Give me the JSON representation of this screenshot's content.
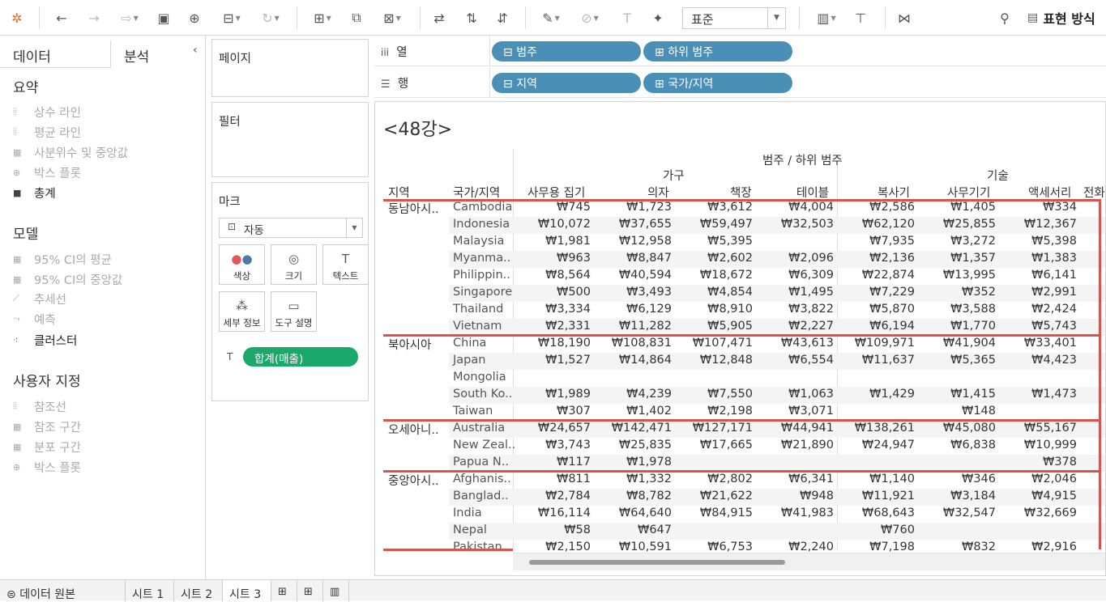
{
  "toolbar": {
    "marks_size_value": "표준",
    "show_me_label": "표현 방식"
  },
  "left_panel": {
    "tab_data": "데이터",
    "tab_analytics": "분석",
    "summary_title": "요약",
    "summary_items": [
      "상수 라인",
      "평균 라인",
      "사분위수 및 중앙값",
      "박스 플롯",
      "총계"
    ],
    "model_title": "모델",
    "model_items": [
      "95% CI의 평균",
      "95% CI의 중앙값",
      "추세선",
      "예측",
      "클러스터"
    ],
    "custom_title": "사용자 지정",
    "custom_items": [
      "참조선",
      "참조 구간",
      "분포 구간",
      "박스 플롯"
    ]
  },
  "cards": {
    "pages_title": "페이지",
    "filters_title": "필터",
    "marks_title": "마크",
    "mark_type": "자동",
    "mark_buttons": [
      "색상",
      "크기",
      "텍스트",
      "세부 정보",
      "도구 설명"
    ],
    "mark_pill": "합계(매출)"
  },
  "shelves": {
    "columns_label": "열",
    "rows_label": "행",
    "column_pills": [
      "범주",
      "하위 범주"
    ],
    "row_pills": [
      "지역",
      "국가/지역"
    ]
  },
  "view": {
    "title": "<48강>",
    "header_top": "범주 / 하위 범주",
    "cat1": "가구",
    "cat2": "기술",
    "row_header_region": "지역",
    "row_header_country": "국가/지역",
    "subcats": [
      "사무용 집기",
      "의자",
      "책장",
      "테이블",
      "복사기",
      "사무기기",
      "액세서리",
      "전화"
    ],
    "regions": [
      "동남아시..",
      "북아시아",
      "오세아니..",
      "중앙아시.."
    ],
    "rows": [
      {
        "country": "Cambodia",
        "vals": [
          "₩745",
          "₩1,723",
          "₩3,612",
          "₩4,004",
          "₩2,586",
          "₩1,405",
          "₩334"
        ]
      },
      {
        "country": "Indonesia",
        "vals": [
          "₩10,072",
          "₩37,655",
          "₩59,497",
          "₩32,503",
          "₩62,120",
          "₩25,855",
          "₩12,367"
        ]
      },
      {
        "country": "Malaysia",
        "vals": [
          "₩1,981",
          "₩12,958",
          "₩5,395",
          "",
          "₩7,935",
          "₩3,272",
          "₩5,398"
        ]
      },
      {
        "country": "Myanma..",
        "vals": [
          "₩963",
          "₩8,847",
          "₩2,602",
          "₩2,096",
          "₩2,136",
          "₩1,357",
          "₩1,383"
        ]
      },
      {
        "country": "Philippin..",
        "vals": [
          "₩8,564",
          "₩40,594",
          "₩18,672",
          "₩6,309",
          "₩22,874",
          "₩13,995",
          "₩6,141"
        ]
      },
      {
        "country": "Singapore",
        "vals": [
          "₩500",
          "₩3,493",
          "₩4,854",
          "₩1,495",
          "₩7,229",
          "₩352",
          "₩2,991"
        ]
      },
      {
        "country": "Thailand",
        "vals": [
          "₩3,334",
          "₩6,129",
          "₩8,910",
          "₩3,822",
          "₩5,870",
          "₩3,588",
          "₩2,424"
        ]
      },
      {
        "country": "Vietnam",
        "vals": [
          "₩2,331",
          "₩11,282",
          "₩5,905",
          "₩2,227",
          "₩6,194",
          "₩1,770",
          "₩5,743"
        ]
      },
      {
        "country": "China",
        "vals": [
          "₩18,190",
          "₩108,831",
          "₩107,471",
          "₩43,613",
          "₩109,971",
          "₩41,904",
          "₩33,401"
        ]
      },
      {
        "country": "Japan",
        "vals": [
          "₩1,527",
          "₩14,864",
          "₩12,848",
          "₩6,554",
          "₩11,637",
          "₩5,365",
          "₩4,423"
        ]
      },
      {
        "country": "Mongolia",
        "vals": [
          "",
          "",
          "",
          "",
          "",
          "",
          ""
        ]
      },
      {
        "country": "South Ko..",
        "vals": [
          "₩1,989",
          "₩4,239",
          "₩7,550",
          "₩1,063",
          "₩1,429",
          "₩1,415",
          "₩1,473"
        ]
      },
      {
        "country": "Taiwan",
        "vals": [
          "₩307",
          "₩1,402",
          "₩2,198",
          "₩3,071",
          "",
          "₩148",
          ""
        ]
      },
      {
        "country": "Australia",
        "vals": [
          "₩24,657",
          "₩142,471",
          "₩127,171",
          "₩44,941",
          "₩138,261",
          "₩45,080",
          "₩55,167"
        ]
      },
      {
        "country": "New Zeal..",
        "vals": [
          "₩3,743",
          "₩25,835",
          "₩17,665",
          "₩21,890",
          "₩24,947",
          "₩6,838",
          "₩10,999"
        ]
      },
      {
        "country": "Papua N..",
        "vals": [
          "₩117",
          "₩1,978",
          "",
          "",
          "",
          "",
          "₩378"
        ]
      },
      {
        "country": "Afghanis..",
        "vals": [
          "₩811",
          "₩1,332",
          "₩2,802",
          "₩6,341",
          "₩1,140",
          "₩346",
          "₩2,046"
        ]
      },
      {
        "country": "Banglad..",
        "vals": [
          "₩2,784",
          "₩8,782",
          "₩21,622",
          "₩948",
          "₩11,921",
          "₩3,184",
          "₩4,915"
        ]
      },
      {
        "country": "India",
        "vals": [
          "₩16,114",
          "₩64,640",
          "₩84,915",
          "₩41,983",
          "₩68,643",
          "₩32,547",
          "₩32,669"
        ]
      },
      {
        "country": "Nepal",
        "vals": [
          "₩58",
          "₩647",
          "",
          "",
          "₩760",
          "",
          ""
        ]
      },
      {
        "country": "Pakistan",
        "vals": [
          "₩2,150",
          "₩10,591",
          "₩6,753",
          "₩2,240",
          "₩7,198",
          "₩832",
          "₩2,916"
        ]
      }
    ]
  },
  "bottom": {
    "datasource": "데이터 원본",
    "sheets": [
      "시트 1",
      "시트 2",
      "시트 3"
    ]
  },
  "colors": {
    "pill_blue": "#4a8fb5",
    "pill_green": "#1aa86b",
    "highlight_red": "#d9534f"
  }
}
